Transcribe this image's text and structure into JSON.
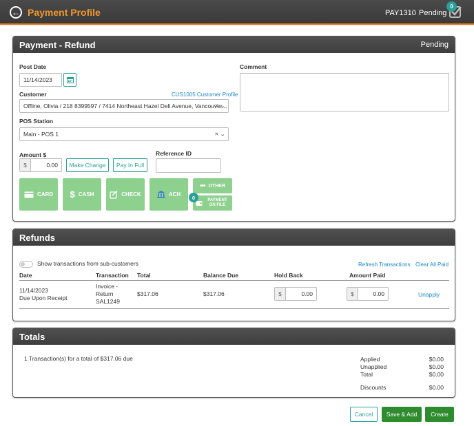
{
  "header": {
    "title": "Payment Profile",
    "payment_id": "PAY1310",
    "status": "Pending",
    "notification_count": "0"
  },
  "payment_panel": {
    "title": "Payment - Refund",
    "status": "Pending",
    "post_date_label": "Post Date",
    "post_date_value": "11/14/2023",
    "comment_label": "Comment",
    "customer_label": "Customer",
    "customer_profile_link": "CUS1005 Customer Profile",
    "customer_value": "Offline, Olivia / 218 8399597 / 7414 Northeast Hazel Dell Avenue, Vancouver...",
    "pos_label": "POS Station",
    "pos_value": "Main - POS 1",
    "amount_label": "Amount $",
    "currency_symbol": "$",
    "amount_value": "0.00",
    "make_change_label": "Make Change",
    "pay_in_full_label": "Pay In Full",
    "reference_label": "Reference ID",
    "reference_value": "",
    "methods": {
      "card": "CARD",
      "cash": "CASH",
      "check": "CHECK",
      "ach": "ACH",
      "other": "OTHER",
      "payment_on_file_line1": "PAYMENT",
      "payment_on_file_line2": "ON FILE",
      "payment_on_file_count": "0"
    }
  },
  "refunds_panel": {
    "title": "Refunds",
    "toggle_label": "Show transactions from sub-customers",
    "refresh_link": "Refresh Transactions",
    "clear_link": "Clear All Paid",
    "columns": {
      "date": "Date",
      "transaction": "Transaction",
      "total": "Total",
      "balance_due": "Balance Due",
      "hold_back": "Hold Back",
      "amount_paid": "Amount Paid"
    },
    "rows": [
      {
        "date": "11/14/2023",
        "terms": "Due Upon Receipt",
        "transaction_line1": "Invoice -",
        "transaction_line2": "Return",
        "transaction_line3": "SAL1249",
        "total": "$317.06",
        "balance_due": "$317.06",
        "hold_back": "0.00",
        "amount_paid": "0.00",
        "action": "Unapply"
      }
    ]
  },
  "totals_panel": {
    "title": "Totals",
    "summary": "1 Transaction(s) for a total of $317.06 due",
    "applied_label": "Applied",
    "applied_value": "$0.00",
    "unapplied_label": "Unapplied",
    "unapplied_value": "$0.00",
    "total_label": "Total",
    "total_value": "$0.00",
    "discounts_label": "Discounts",
    "discounts_value": "$0.00"
  },
  "footer": {
    "cancel_label": "Cancel",
    "save_add_label": "Save & Add",
    "create_label": "Create"
  },
  "colors": {
    "accent": "#f0962e",
    "teal": "#2aa09a",
    "method_green": "#8ed08e",
    "primary_green": "#2e8b2e",
    "link_blue": "#1e88c8"
  }
}
